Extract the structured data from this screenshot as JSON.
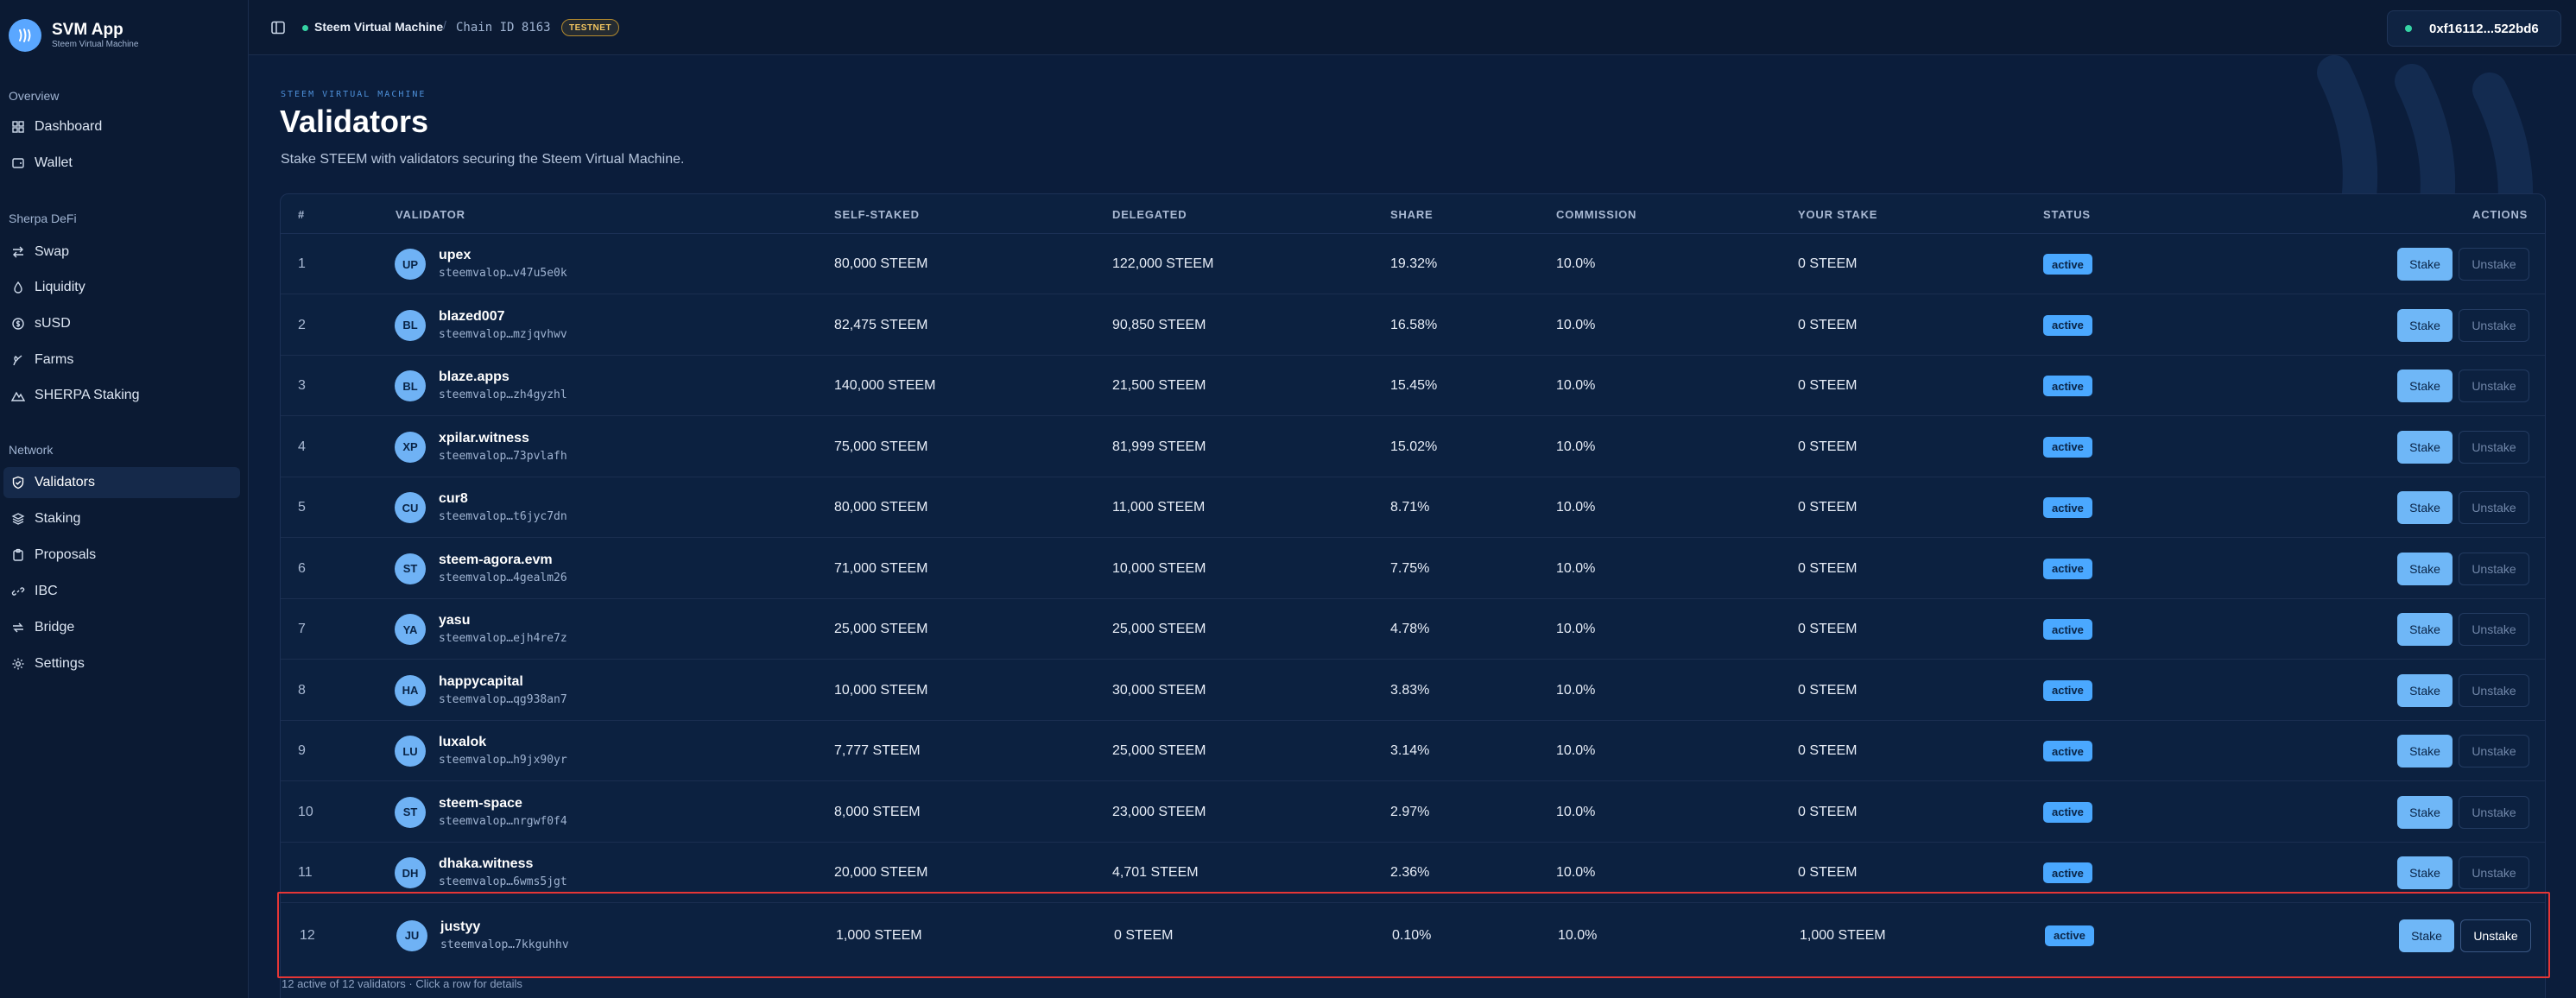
{
  "brand": {
    "name": "SVM App",
    "subtitle": "Steem Virtual Machine"
  },
  "sidebar": {
    "groups": [
      {
        "title": "Overview",
        "items": [
          {
            "label": "Dashboard",
            "icon": "grid-icon"
          },
          {
            "label": "Wallet",
            "icon": "wallet-icon"
          }
        ]
      },
      {
        "title": "Sherpa DeFi",
        "items": [
          {
            "label": "Swap",
            "icon": "swap-arrows-icon"
          },
          {
            "label": "Liquidity",
            "icon": "droplet-icon"
          },
          {
            "label": "sUSD",
            "icon": "dollar-circle-icon"
          },
          {
            "label": "Farms",
            "icon": "sprout-icon"
          },
          {
            "label": "SHERPA Staking",
            "icon": "mountain-icon"
          }
        ]
      },
      {
        "title": "Network",
        "items": [
          {
            "label": "Validators",
            "icon": "shield-check-icon",
            "active": true
          },
          {
            "label": "Staking",
            "icon": "layers-icon"
          },
          {
            "label": "Proposals",
            "icon": "clipboard-icon"
          },
          {
            "label": "IBC",
            "icon": "link-icon"
          },
          {
            "label": "Bridge",
            "icon": "bridge-arrows-icon"
          },
          {
            "label": "Settings",
            "icon": "gear-icon"
          }
        ]
      }
    ]
  },
  "topbar": {
    "chain_name": "Steem Virtual Machine",
    "separator": "/",
    "chain_id": "Chain ID 8163",
    "network_badge": "TESTNET",
    "wallet_address": "0xf16112...522bd6"
  },
  "page": {
    "eyebrow": "STEEM VIRTUAL MACHINE",
    "title": "Validators",
    "subtitle": "Stake STEEM with validators securing the Steem Virtual Machine."
  },
  "table": {
    "headers": {
      "num": "#",
      "validator": "VALIDATOR",
      "self_staked": "SELF-STAKED",
      "delegated": "DELEGATED",
      "share": "SHARE",
      "commission": "COMMISSION",
      "your_stake": "YOUR STAKE",
      "status": "STATUS",
      "actions": "ACTIONS"
    },
    "stake_label": "Stake",
    "unstake_label": "Unstake",
    "rows": [
      {
        "num": "1",
        "initials": "UP",
        "name": "upex",
        "address": "steemvalop…v47u5e0k",
        "self_staked": "80,000 STEEM",
        "delegated": "122,000 STEEM",
        "share": "19.32%",
        "commission": "10.0%",
        "your_stake": "0 STEEM",
        "status": "active"
      },
      {
        "num": "2",
        "initials": "BL",
        "name": "blazed007",
        "address": "steemvalop…mzjqvhwv",
        "self_staked": "82,475 STEEM",
        "delegated": "90,850 STEEM",
        "share": "16.58%",
        "commission": "10.0%",
        "your_stake": "0 STEEM",
        "status": "active"
      },
      {
        "num": "3",
        "initials": "BL",
        "name": "blaze.apps",
        "address": "steemvalop…zh4gyzhl",
        "self_staked": "140,000 STEEM",
        "delegated": "21,500 STEEM",
        "share": "15.45%",
        "commission": "10.0%",
        "your_stake": "0 STEEM",
        "status": "active"
      },
      {
        "num": "4",
        "initials": "XP",
        "name": "xpilar.witness",
        "address": "steemvalop…73pvlafh",
        "self_staked": "75,000 STEEM",
        "delegated": "81,999 STEEM",
        "share": "15.02%",
        "commission": "10.0%",
        "your_stake": "0 STEEM",
        "status": "active"
      },
      {
        "num": "5",
        "initials": "CU",
        "name": "cur8",
        "address": "steemvalop…t6jyc7dn",
        "self_staked": "80,000 STEEM",
        "delegated": "11,000 STEEM",
        "share": "8.71%",
        "commission": "10.0%",
        "your_stake": "0 STEEM",
        "status": "active"
      },
      {
        "num": "6",
        "initials": "ST",
        "name": "steem-agora.evm",
        "address": "steemvalop…4gealm26",
        "self_staked": "71,000 STEEM",
        "delegated": "10,000 STEEM",
        "share": "7.75%",
        "commission": "10.0%",
        "your_stake": "0 STEEM",
        "status": "active"
      },
      {
        "num": "7",
        "initials": "YA",
        "name": "yasu",
        "address": "steemvalop…ejh4re7z",
        "self_staked": "25,000 STEEM",
        "delegated": "25,000 STEEM",
        "share": "4.78%",
        "commission": "10.0%",
        "your_stake": "0 STEEM",
        "status": "active"
      },
      {
        "num": "8",
        "initials": "HA",
        "name": "happycapital",
        "address": "steemvalop…qg938an7",
        "self_staked": "10,000 STEEM",
        "delegated": "30,000 STEEM",
        "share": "3.83%",
        "commission": "10.0%",
        "your_stake": "0 STEEM",
        "status": "active"
      },
      {
        "num": "9",
        "initials": "LU",
        "name": "luxalok",
        "address": "steemvalop…h9jx90yr",
        "self_staked": "7,777 STEEM",
        "delegated": "25,000 STEEM",
        "share": "3.14%",
        "commission": "10.0%",
        "your_stake": "0 STEEM",
        "status": "active"
      },
      {
        "num": "10",
        "initials": "ST",
        "name": "steem-space",
        "address": "steemvalop…nrgwf0f4",
        "self_staked": "8,000 STEEM",
        "delegated": "23,000 STEEM",
        "share": "2.97%",
        "commission": "10.0%",
        "your_stake": "0 STEEM",
        "status": "active"
      },
      {
        "num": "11",
        "initials": "DH",
        "name": "dhaka.witness",
        "address": "steemvalop…6wms5jgt",
        "self_staked": "20,000 STEEM",
        "delegated": "4,701 STEEM",
        "share": "2.36%",
        "commission": "10.0%",
        "your_stake": "0 STEEM",
        "status": "active"
      },
      {
        "num": "12",
        "initials": "JU",
        "name": "justyy",
        "address": "steemvalop…7kkguhhv",
        "self_staked": "1,000 STEEM",
        "delegated": "0 STEEM",
        "share": "0.10%",
        "commission": "10.0%",
        "your_stake": "1,000 STEEM",
        "status": "active",
        "unstake_enabled": true,
        "highlighted": true
      }
    ],
    "footer_note": "12 active of 12 validators · Click a row for details"
  },
  "colors": {
    "accent": "#4aa8ff",
    "highlight_border": "#e53636",
    "online": "#35d3a4",
    "testnet": "#f0c460"
  }
}
